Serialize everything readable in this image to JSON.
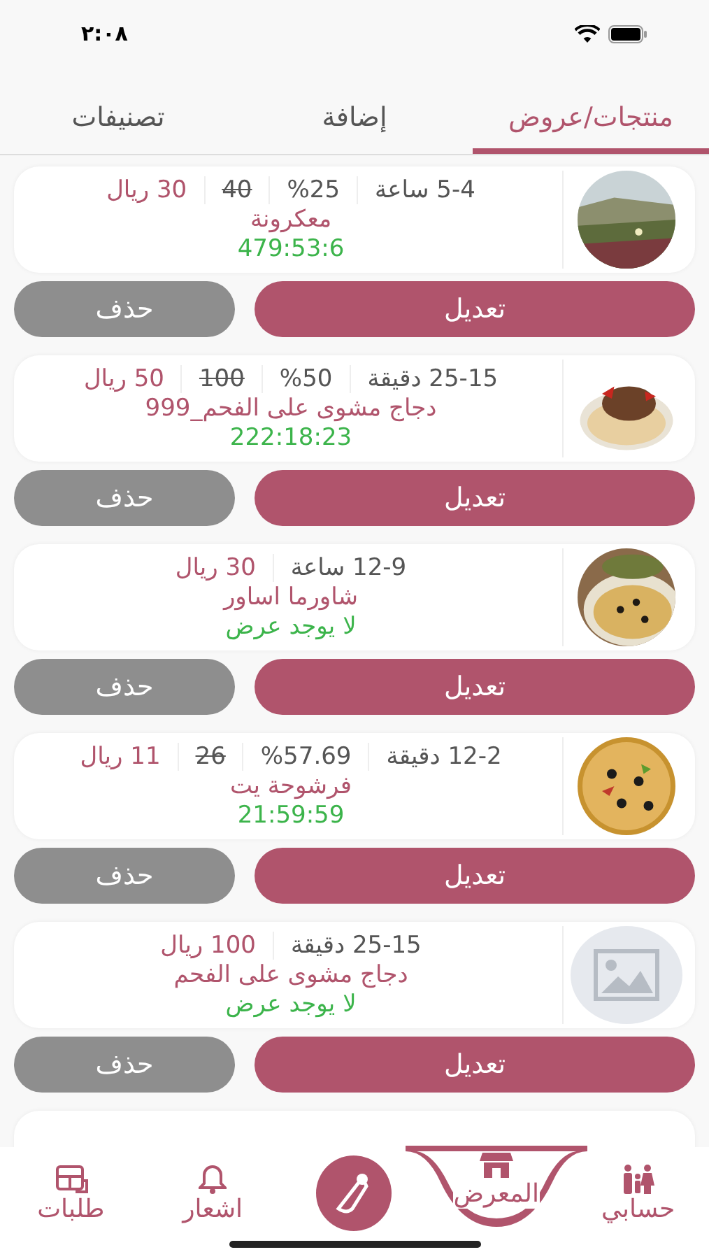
{
  "status_bar": {
    "time": "٢:٠٨"
  },
  "tabs": [
    {
      "label": "منتجات/عروض",
      "selected": true
    },
    {
      "label": "إضافة",
      "selected": false
    },
    {
      "label": "تصنيفات",
      "selected": false
    }
  ],
  "products": [
    {
      "duration": "5-4 ساعة",
      "discount": "%25",
      "old_price": "40",
      "price": "30 ريال",
      "name": "معكرونة",
      "status": "479:53:6",
      "edit": "تعديل",
      "delete": "حذف"
    },
    {
      "duration": "25-15 دقيقة",
      "discount": "%50",
      "old_price": "100",
      "price": "50 ريال",
      "name": "دجاج مشوى على الفحم_999",
      "status": "222:18:23",
      "edit": "تعديل",
      "delete": "حذف"
    },
    {
      "duration": "12-9 ساعة",
      "price": "30 ريال",
      "name": "شاورما اساور",
      "status": "لا يوجد عرض",
      "edit": "تعديل",
      "delete": "حذف"
    },
    {
      "duration": "12-2 دقيقة",
      "discount": "%57.69",
      "old_price": "26",
      "price": "11 ريال",
      "name": "فرشوحة يت",
      "status": "21:59:59",
      "edit": "تعديل",
      "delete": "حذف"
    },
    {
      "thumbnail": {
        "kind": "placeholder"
      },
      "duration": "25-15 دقيقة",
      "price": "100 ريال",
      "name": "دجاج مشوى على الفحم",
      "status": "لا يوجد عرض",
      "edit": "تعديل",
      "delete": "حذف"
    }
  ],
  "bottom_nav": [
    {
      "kind": "tab",
      "label": "حسابي",
      "selected": false
    },
    {
      "kind": "tab",
      "label": "المعرض",
      "selected": true
    },
    {
      "kind": "logo"
    },
    {
      "kind": "tab",
      "label": "اشعار",
      "selected": false
    },
    {
      "kind": "tab",
      "label": "طلبات",
      "selected": false
    }
  ]
}
